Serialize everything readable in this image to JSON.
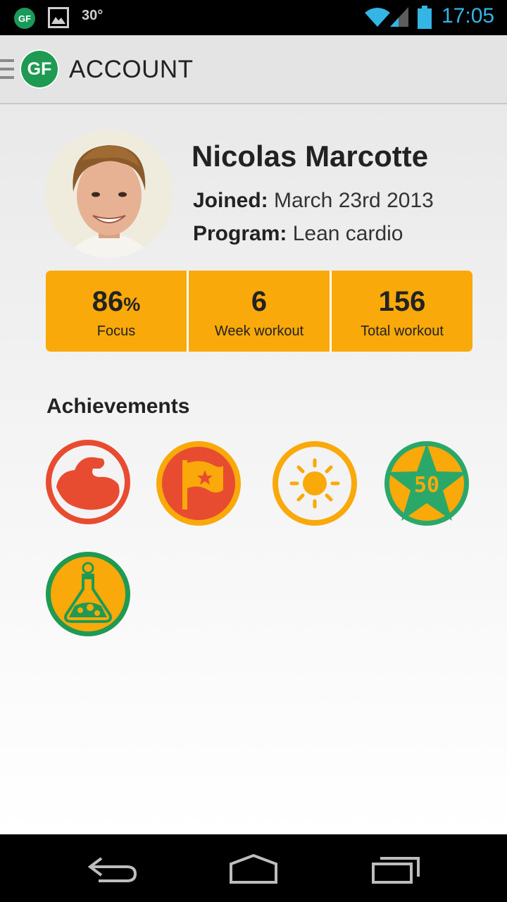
{
  "status_bar": {
    "app_icon_text": "GF",
    "temperature": "30°",
    "time": "17:05",
    "icons": [
      "app-notification-icon",
      "gallery-icon",
      "wifi-icon",
      "signal-icon",
      "battery-icon"
    ]
  },
  "action_bar": {
    "logo_text": "GF",
    "title": "ACCOUNT"
  },
  "profile": {
    "name": "Nicolas Marcotte",
    "joined_label": "Joined:",
    "joined_value": "March 23rd 2013",
    "program_label": "Program:",
    "program_value": "Lean cardio"
  },
  "stats": [
    {
      "value": "86",
      "unit": "%",
      "label": "Focus"
    },
    {
      "value": "6",
      "unit": "",
      "label": "Week workout"
    },
    {
      "value": "156",
      "unit": "",
      "label": "Total workout"
    }
  ],
  "achievements": {
    "title": "Achievements",
    "badges": [
      {
        "icon": "muscle-badge-icon",
        "ring": "#e84c30",
        "fill": "#f3f3f3"
      },
      {
        "icon": "flag-badge-icon",
        "ring": "#f9a90a",
        "fill": "#e84c30"
      },
      {
        "icon": "sun-badge-icon",
        "ring": "#f9a90a",
        "fill": "#f3f3f3"
      },
      {
        "icon": "star-50-badge-icon",
        "ring": "#f9a90a",
        "fill": "#2aa86a",
        "text": "50"
      },
      {
        "icon": "potion-badge-icon",
        "ring": "#1f9a52",
        "fill": "#f9a90a"
      }
    ]
  },
  "colors": {
    "accent_orange": "#f9a90a",
    "red": "#e84c30",
    "green": "#1f9a52",
    "clock_blue": "#33b5e5"
  },
  "nav_bar": {
    "buttons": [
      "back-icon",
      "home-icon",
      "recent-apps-icon"
    ]
  }
}
